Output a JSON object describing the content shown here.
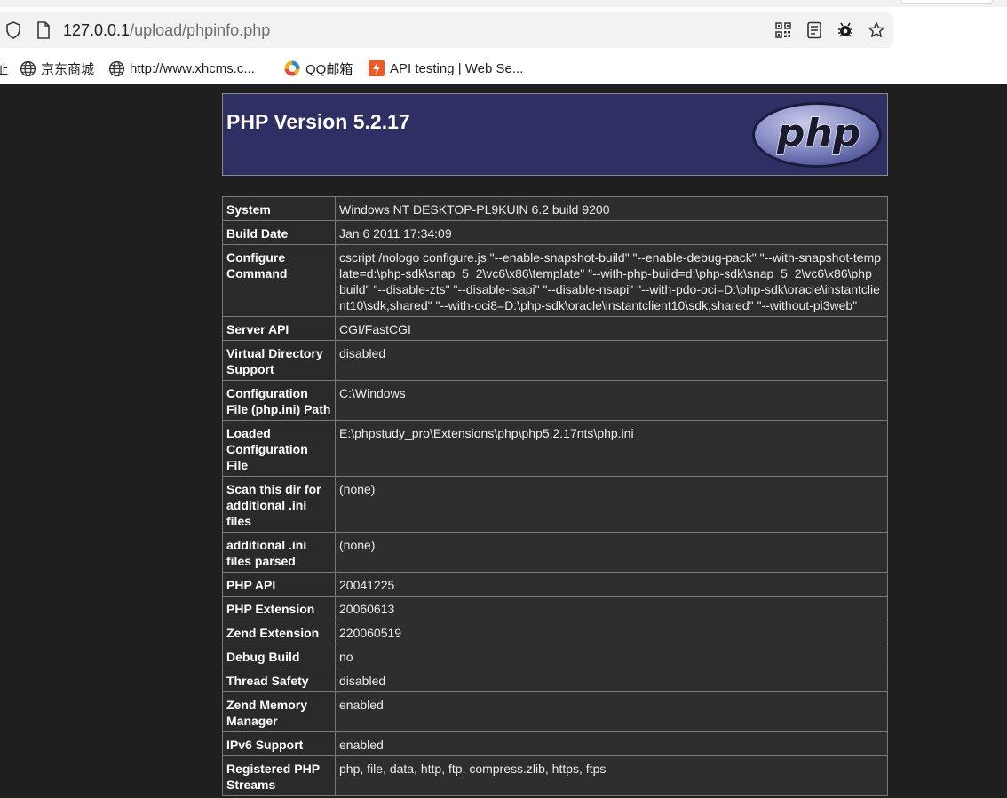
{
  "browser": {
    "url_host": "127.0.0.1",
    "url_path": "/upload/phpinfo.php",
    "toolbar_icons": [
      "qr-code-icon",
      "reader-mode-icon",
      "bug-extension-icon",
      "favorite-star-icon"
    ],
    "bookmarks": [
      {
        "label": "京东商城",
        "icon": "globe-icon"
      },
      {
        "label": "http://www.xhcms.c...",
        "icon": "globe-icon"
      },
      {
        "label": "QQ邮箱",
        "icon": "qq-mail-icon"
      },
      {
        "label": "API testing | Web Se...",
        "icon": "api-testing-icon"
      }
    ],
    "partial_left_bookmark": "址"
  },
  "php": {
    "version_title": "PHP Version 5.2.17",
    "logo_text": "php",
    "rows": [
      {
        "key": "System",
        "value": "Windows NT DESKTOP-PL9KUIN 6.2 build 9200"
      },
      {
        "key": "Build Date",
        "value": "Jan 6 2011 17:34:09"
      },
      {
        "key": "Configure Command",
        "value": "cscript /nologo configure.js \"--enable-snapshot-build\" \"--enable-debug-pack\" \"--with-snapshot-template=d:\\php-sdk\\snap_5_2\\vc6\\x86\\template\" \"--with-php-build=d:\\php-sdk\\snap_5_2\\vc6\\x86\\php_build\" \"--disable-zts\" \"--disable-isapi\" \"--disable-nsapi\" \"--with-pdo-oci=D:\\php-sdk\\oracle\\instantclient10\\sdk,shared\" \"--with-oci8=D:\\php-sdk\\oracle\\instantclient10\\sdk,shared\" \"--without-pi3web\""
      },
      {
        "key": "Server API",
        "value": "CGI/FastCGI"
      },
      {
        "key": "Virtual Directory Support",
        "value": "disabled"
      },
      {
        "key": "Configuration File (php.ini) Path",
        "value": "C:\\Windows"
      },
      {
        "key": "Loaded Configuration File",
        "value": "E:\\phpstudy_pro\\Extensions\\php\\php5.2.17nts\\php.ini"
      },
      {
        "key": "Scan this dir for additional .ini files",
        "value": "(none)"
      },
      {
        "key": "additional .ini files parsed",
        "value": "(none)"
      },
      {
        "key": "PHP API",
        "value": "20041225"
      },
      {
        "key": "PHP Extension",
        "value": "20060613"
      },
      {
        "key": "Zend Extension",
        "value": "220060519"
      },
      {
        "key": "Debug Build",
        "value": "no"
      },
      {
        "key": "Thread Safety",
        "value": "disabled"
      },
      {
        "key": "Zend Memory Manager",
        "value": "enabled"
      },
      {
        "key": "IPv6 Support",
        "value": "enabled"
      },
      {
        "key": "Registered PHP Streams",
        "value": "php, file, data, http, ftp, compress.zlib, https, ftps"
      }
    ]
  }
}
